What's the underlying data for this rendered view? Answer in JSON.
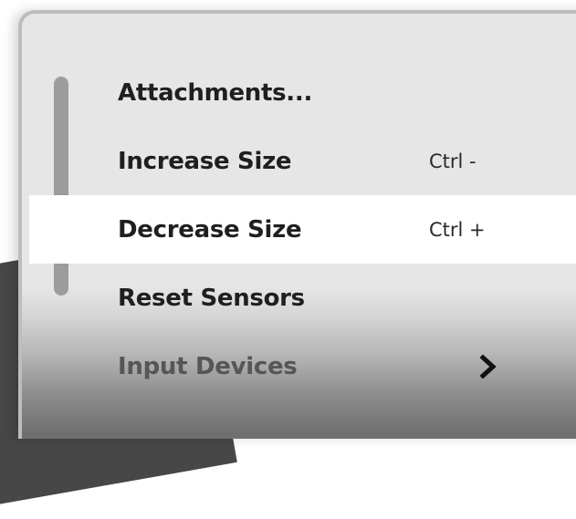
{
  "menu": {
    "items": [
      {
        "label": "Attachments...",
        "shortcut": "",
        "state": "normal"
      },
      {
        "label": "Increase Size",
        "shortcut": "Ctrl -",
        "state": "normal"
      },
      {
        "label": "Decrease Size",
        "shortcut": "Ctrl +",
        "state": "highlighted"
      },
      {
        "label": "Reset Sensors",
        "shortcut": "",
        "state": "normal"
      },
      {
        "label": "Input Devices",
        "shortcut": "",
        "state": "disabled",
        "submenu_icon": "chevron-right-icon"
      }
    ]
  },
  "colors": {
    "menu_background": "#e6e6e6",
    "highlight": "#ffffff",
    "text": "#1f1f1f",
    "scrollbar": "#9c9c9c"
  }
}
